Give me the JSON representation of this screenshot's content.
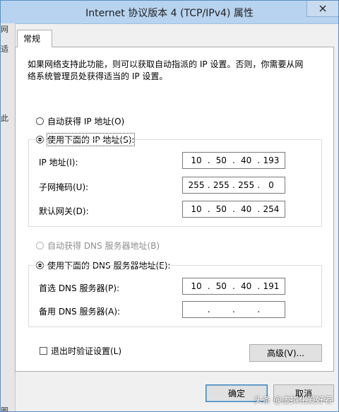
{
  "window": {
    "title": "Internet 协议版本 4 (TCP/IPv4) 属性"
  },
  "background": {
    "left_chars": [
      "网",
      "适",
      "此",
      "图"
    ]
  },
  "tabs": [
    {
      "label": "常规"
    }
  ],
  "description": "如果网络支持此功能，则可以获取自动指派的 IP 设置。否则，你需要从网络系统管理员处获得适当的 IP 设置。",
  "ip_mode": {
    "auto_label": "自动获得 IP 地址(O)",
    "manual_label": "使用下面的 IP 地址(S):",
    "selected": "manual"
  },
  "ip_fields": {
    "ip_label": "IP 地址(I):",
    "ip": [
      "10",
      "50",
      "40",
      "193"
    ],
    "mask_label": "子网掩码(U):",
    "mask": [
      "255",
      "255",
      "255",
      "0"
    ],
    "gateway_label": "默认网关(D):",
    "gateway": [
      "10",
      "50",
      "40",
      "254"
    ]
  },
  "dns_mode": {
    "auto_label": "自动获得 DNS 服务器地址(B)",
    "manual_label": "使用下面的 DNS 服务器地址(E):",
    "selected": "manual"
  },
  "dns_fields": {
    "preferred_label": "首选 DNS 服务器(P):",
    "preferred": [
      "10",
      "50",
      "40",
      "191"
    ],
    "alternate_label": "备用 DNS 服务器(A):",
    "alternate": [
      "",
      "",
      "",
      ""
    ]
  },
  "validate_checkbox": {
    "label": "退出时验证设置(L)",
    "checked": false
  },
  "buttons": {
    "advanced": "高级(V)...",
    "ok": "确定",
    "cancel": "取消"
  },
  "watermark": "头条 @虚拟化爱好者"
}
